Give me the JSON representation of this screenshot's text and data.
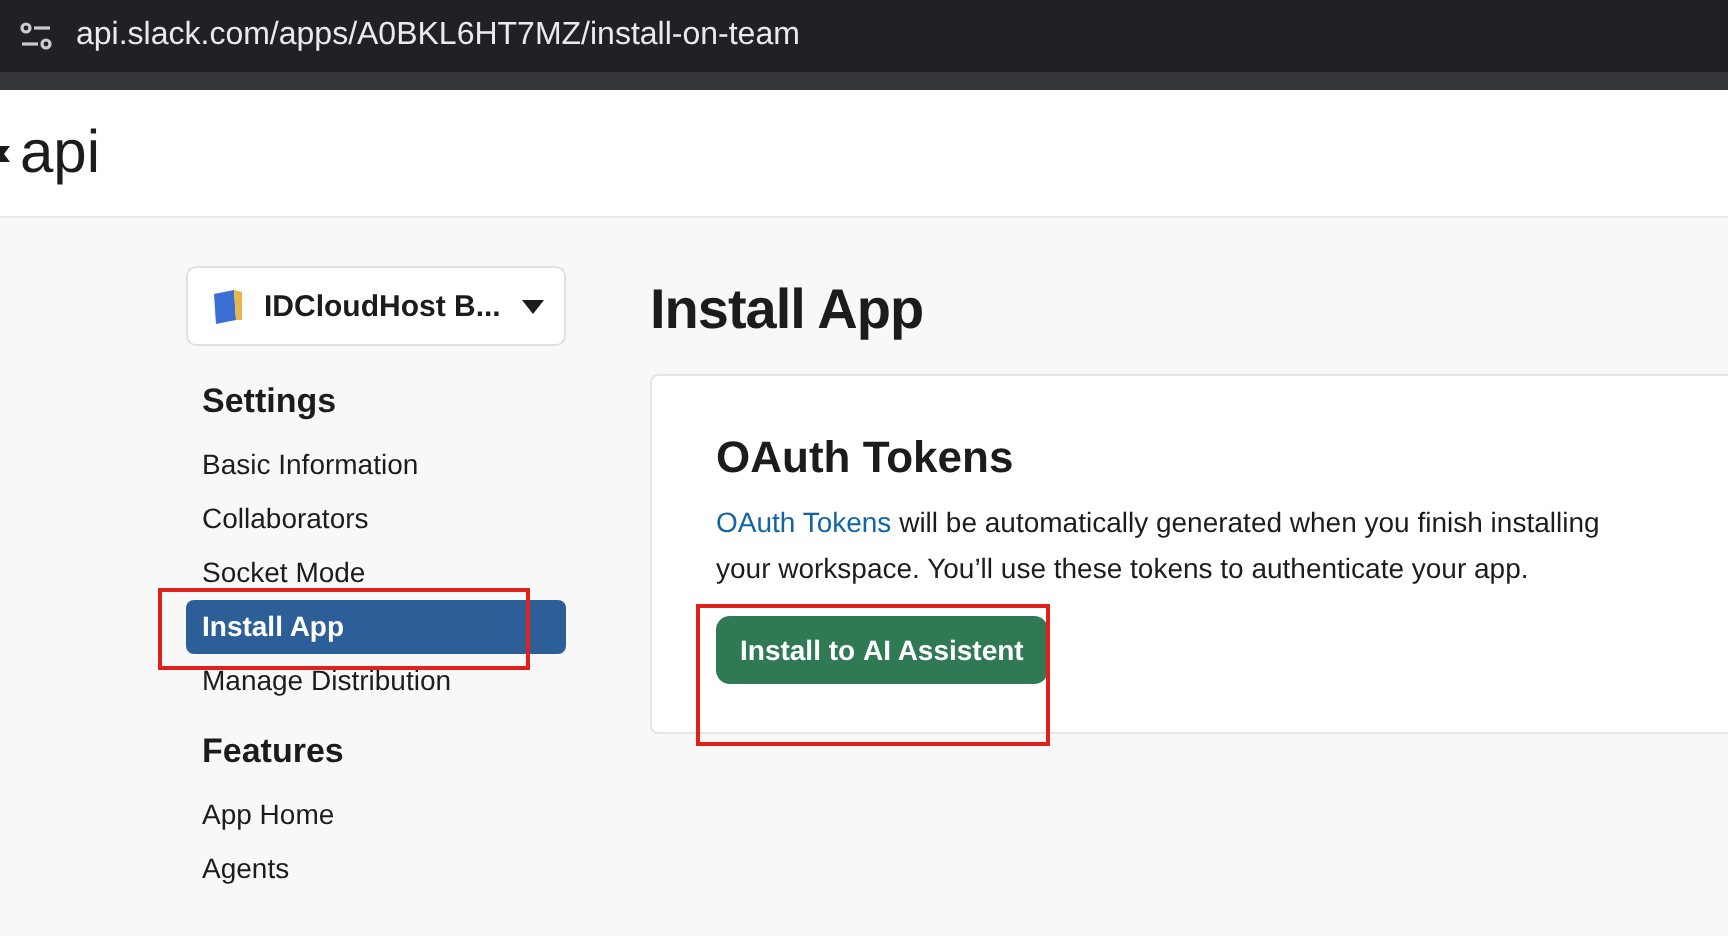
{
  "browser": {
    "url": "api.slack.com/apps/A0BKL6HT7MZ/install-on-team"
  },
  "header": {
    "logo_text": "api"
  },
  "sidebar": {
    "workspace": "IDCloudHost B...",
    "sections": [
      {
        "heading": "Settings",
        "items": [
          {
            "label": "Basic Information",
            "selected": false
          },
          {
            "label": "Collaborators",
            "selected": false
          },
          {
            "label": "Socket Mode",
            "selected": false
          },
          {
            "label": "Install App",
            "selected": true
          },
          {
            "label": "Manage Distribution",
            "selected": false
          }
        ]
      },
      {
        "heading": "Features",
        "items": [
          {
            "label": "App Home",
            "selected": false
          },
          {
            "label": "Agents",
            "selected": false
          }
        ]
      }
    ]
  },
  "page_title": "Install App",
  "card": {
    "title": "OAuth Tokens",
    "link": "OAuth Tokens",
    "line_1": "will be automatically generated when you finish installing",
    "line_2": "your workspace. You’ll use these tokens to authenticate your app.",
    "button": "Install to **AI Assistent**"
  }
}
